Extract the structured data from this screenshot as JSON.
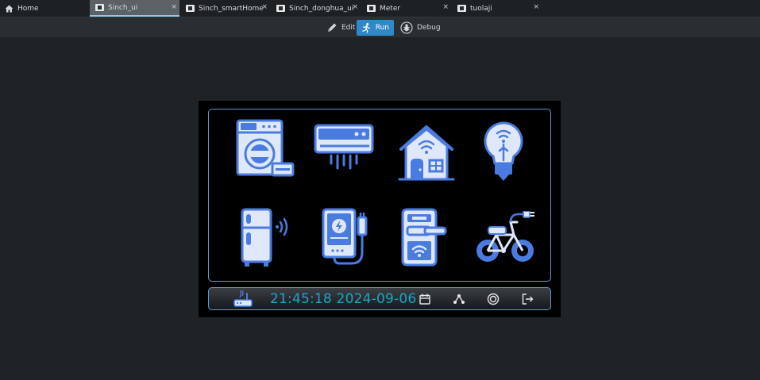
{
  "tabs": [
    {
      "label": "Home",
      "icon": "home-icon",
      "active": false,
      "closable": false
    },
    {
      "label": "Sinch_ui",
      "icon": "window-icon",
      "active": true,
      "closable": true
    },
    {
      "label": "Sinch_smartHome",
      "icon": "window-icon",
      "active": false,
      "closable": true
    },
    {
      "label": "Sinch_donghua_ui",
      "icon": "window-icon",
      "active": false,
      "closable": true
    },
    {
      "label": "Meter",
      "icon": "window-icon",
      "active": false,
      "closable": true
    },
    {
      "label": "tuolaji",
      "icon": "window-icon",
      "active": false,
      "closable": true
    }
  ],
  "close_glyph": "×",
  "toolbar": {
    "edit_label": "Edit",
    "run_label": "Run",
    "debug_label": "Debug"
  },
  "device": {
    "appliances": [
      "washing-machine-icon",
      "air-conditioner-icon",
      "smart-home-icon",
      "smart-bulb-icon",
      "smart-fridge-icon",
      "power-bank-icon",
      "smart-lock-icon",
      "electric-bike-icon"
    ],
    "status": {
      "clock": "21:45:18 2024-09-06",
      "icons": [
        "router-icon",
        "calendar-icon",
        "network-icon",
        "target-icon",
        "logout-icon"
      ]
    }
  },
  "colors": {
    "accent": "#2f89c8",
    "icon_blue": "#4a7be0",
    "icon_light": "#dfe8fb",
    "clock": "#19a6c9",
    "panel_border": "#5a9bd8"
  }
}
